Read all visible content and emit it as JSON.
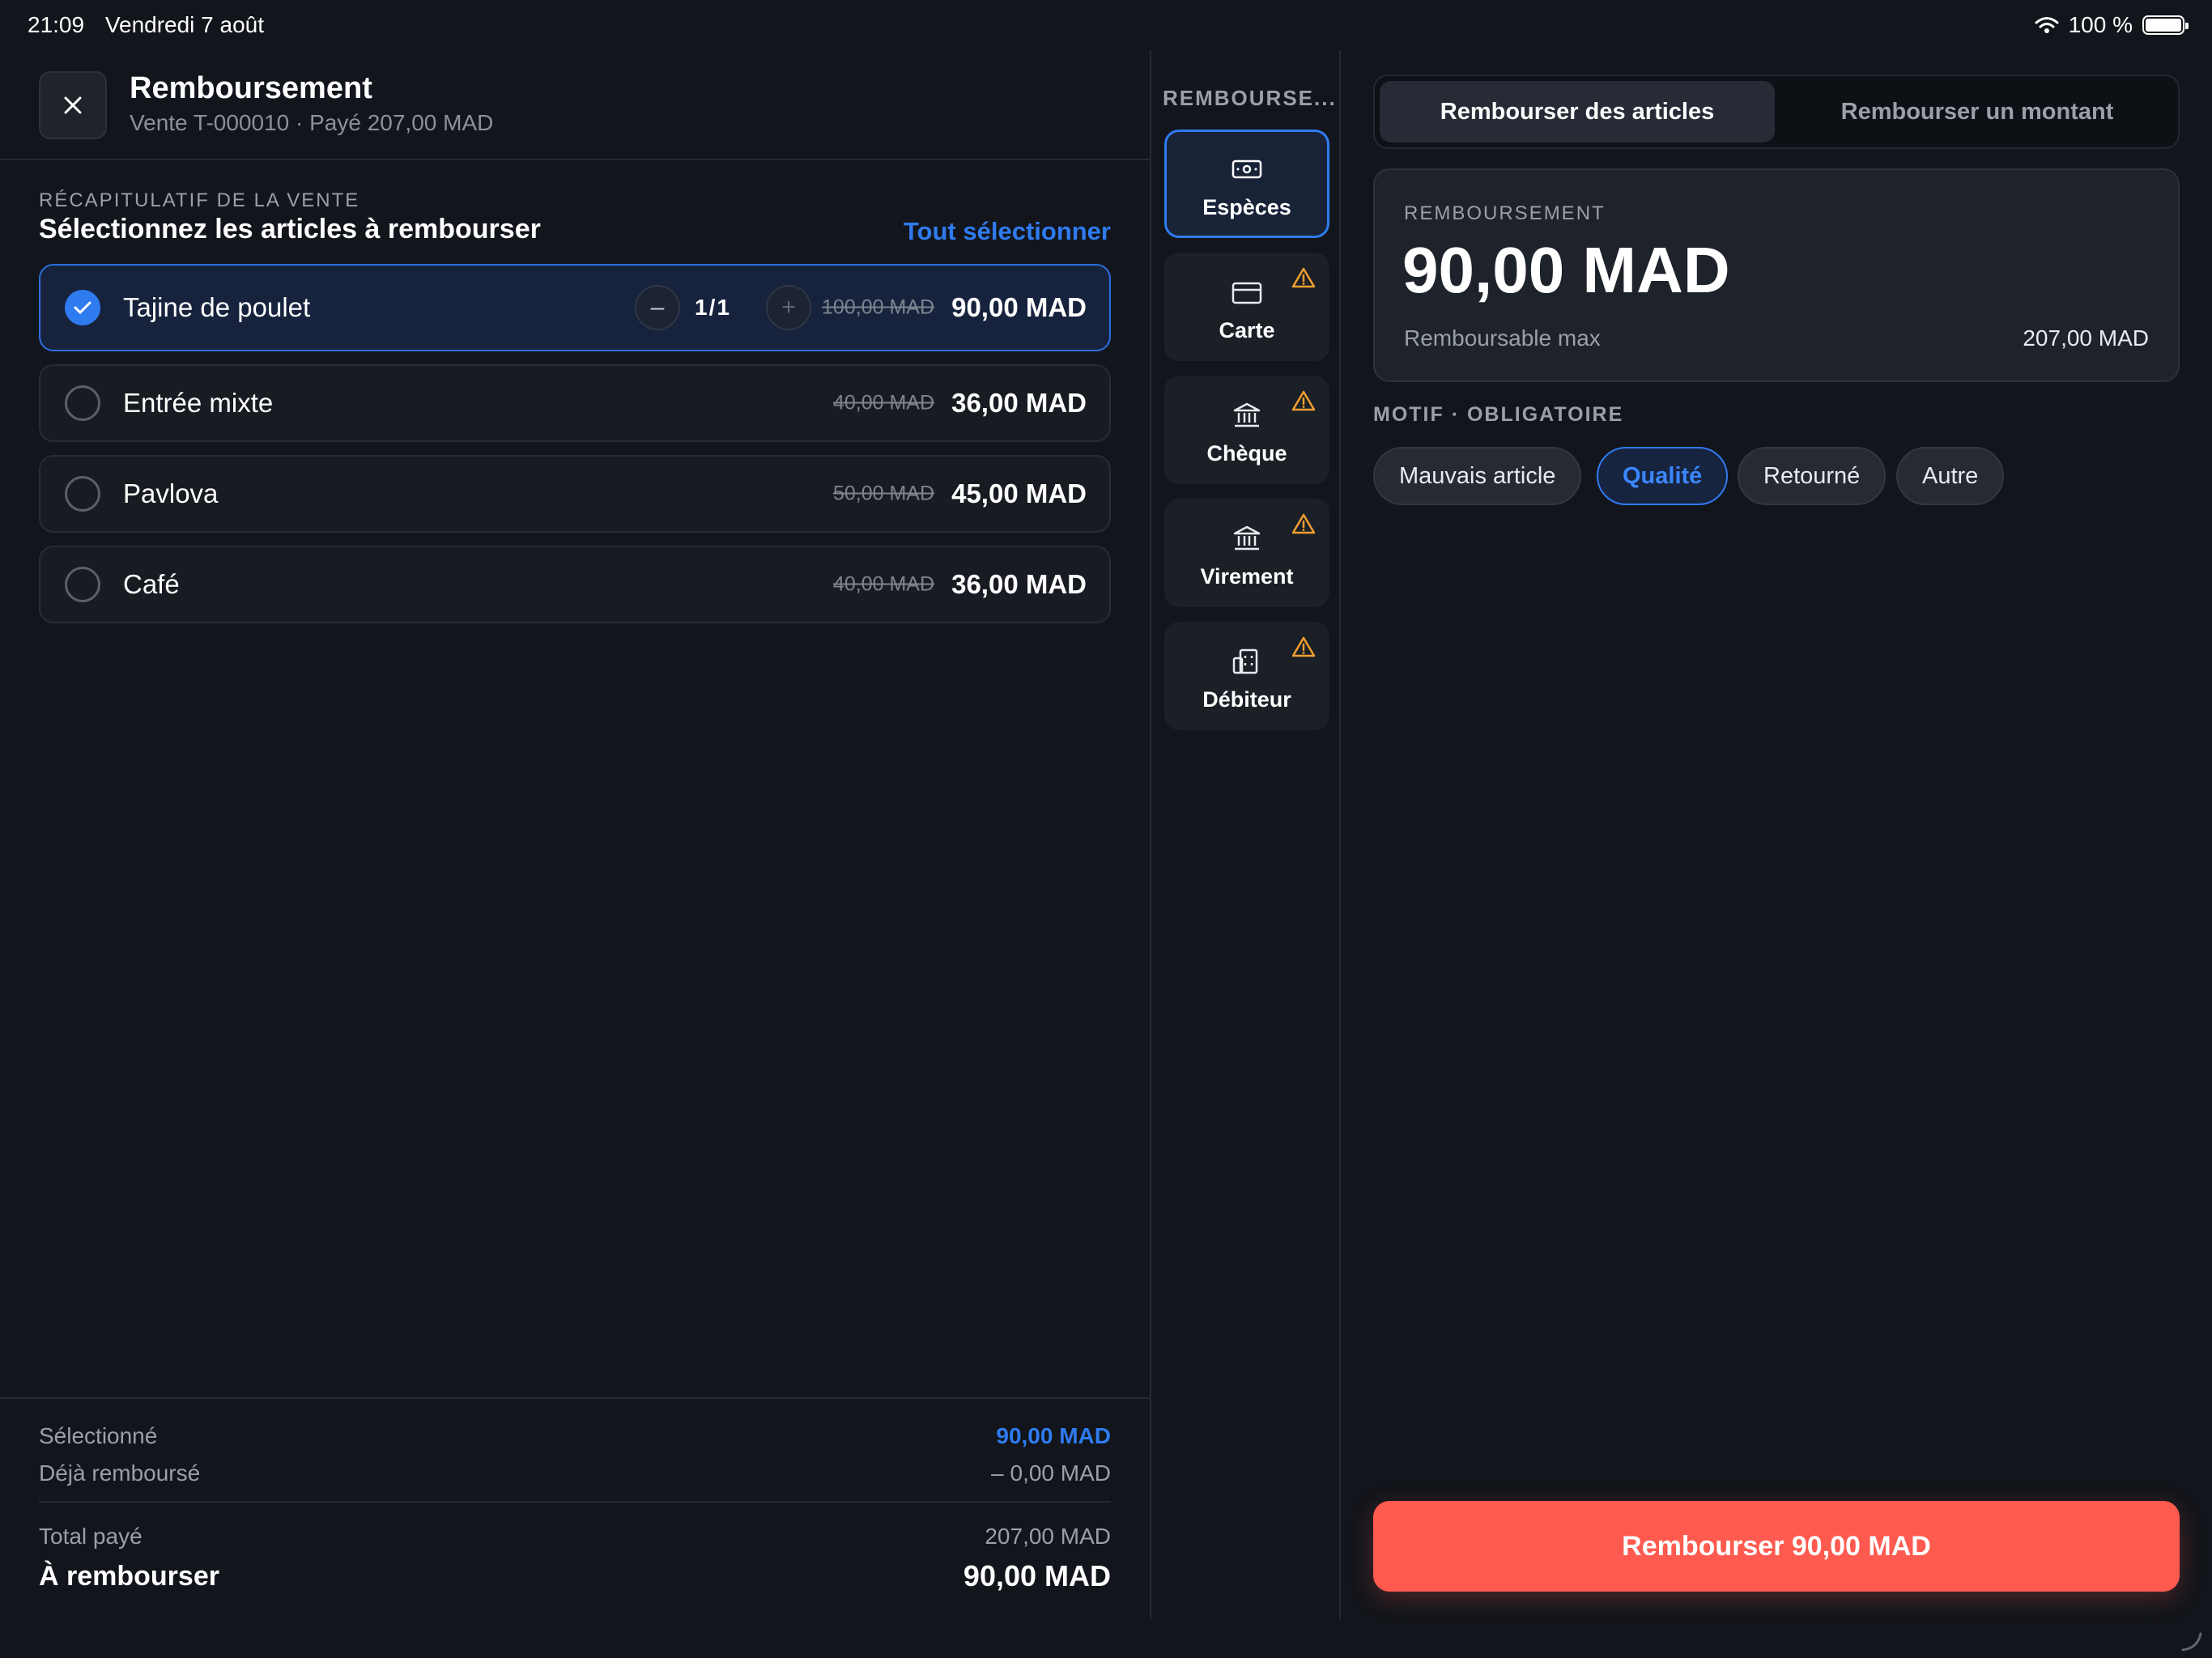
{
  "status": {
    "time": "21:09",
    "date": "Vendredi 7 août",
    "battery": "100 %"
  },
  "header": {
    "title": "Remboursement",
    "subtitle": "Vente T-000010 · Payé 207,00 MAD"
  },
  "summary": {
    "label": "RÉCAPITULATIF DE LA VENTE",
    "title": "Sélectionnez les articles à rembourser",
    "select_all": "Tout sélectionner"
  },
  "items": [
    {
      "name": "Tajine de poulet",
      "old_price": "100,00 MAD",
      "price": "90,00 MAD",
      "qty": "1/1",
      "selected": true
    },
    {
      "name": "Entrée mixte",
      "old_price": "40,00 MAD",
      "price": "36,00 MAD",
      "selected": false
    },
    {
      "name": "Pavlova",
      "old_price": "50,00 MAD",
      "price": "45,00 MAD",
      "selected": false
    },
    {
      "name": "Café",
      "old_price": "40,00 MAD",
      "price": "36,00 MAD",
      "selected": false
    }
  ],
  "footer": {
    "selected_label": "Sélectionné",
    "selected_value": "90,00 MAD",
    "refunded_label": "Déjà remboursé",
    "refunded_value": "– 0,00 MAD",
    "paid_label": "Total payé",
    "paid_value": "207,00 MAD",
    "to_refund_label": "À rembourser",
    "to_refund_value": "90,00 MAD"
  },
  "methods": {
    "title": "REMBOURSE...",
    "items": [
      {
        "label": "Espèces",
        "icon": "cash-icon",
        "active": true,
        "warning": false
      },
      {
        "label": "Carte",
        "icon": "card-icon",
        "active": false,
        "warning": true
      },
      {
        "label": "Chèque",
        "icon": "bank-icon",
        "active": false,
        "warning": true
      },
      {
        "label": "Virement",
        "icon": "bank-icon",
        "active": false,
        "warning": true
      },
      {
        "label": "Débiteur",
        "icon": "building-icon",
        "active": false,
        "warning": true
      }
    ]
  },
  "tabs": {
    "items": "Rembourser des articles",
    "amount": "Rembourser un montant",
    "active": "items"
  },
  "refund_card": {
    "label": "REMBOURSEMENT",
    "amount": "90,00 MAD",
    "max_label": "Remboursable max",
    "max_value": "207,00 MAD"
  },
  "motif": {
    "label": "MOTIF · OBLIGATOIRE",
    "options": [
      "Mauvais article",
      "Qualité",
      "Retourné",
      "Autre"
    ],
    "selected": "Qualité"
  },
  "cta": {
    "label": "Rembourser 90,00 MAD"
  },
  "colors": {
    "accent": "#2f7bf0",
    "danger": "#ff5a4f",
    "warning": "#f0a030",
    "background": "#12151b"
  }
}
